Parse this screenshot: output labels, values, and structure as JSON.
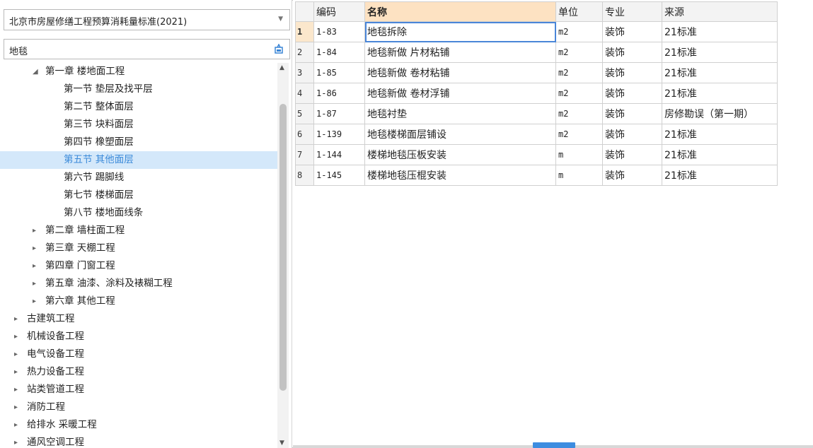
{
  "dropdown": {
    "value": "北京市房屋修缮工程预算消耗量标准(2021)"
  },
  "search": {
    "value": "地毯"
  },
  "tree": [
    {
      "label": "第一章 楼地面工程",
      "level": 1,
      "toggle": "expanded",
      "selected": false
    },
    {
      "label": "第一节 垫层及找平层",
      "level": 2,
      "toggle": "none",
      "selected": false
    },
    {
      "label": "第二节 整体面层",
      "level": 2,
      "toggle": "none",
      "selected": false
    },
    {
      "label": "第三节 块料面层",
      "level": 2,
      "toggle": "none",
      "selected": false
    },
    {
      "label": "第四节 橡塑面层",
      "level": 2,
      "toggle": "none",
      "selected": false
    },
    {
      "label": "第五节 其他面层",
      "level": 2,
      "toggle": "none",
      "selected": true
    },
    {
      "label": "第六节 踢脚线",
      "level": 2,
      "toggle": "none",
      "selected": false
    },
    {
      "label": "第七节 楼梯面层",
      "level": 2,
      "toggle": "none",
      "selected": false
    },
    {
      "label": "第八节 楼地面线条",
      "level": 2,
      "toggle": "none",
      "selected": false
    },
    {
      "label": "第二章 墙柱面工程",
      "level": 1,
      "toggle": "collapsed",
      "selected": false
    },
    {
      "label": "第三章 天棚工程",
      "level": 1,
      "toggle": "collapsed",
      "selected": false
    },
    {
      "label": "第四章 门窗工程",
      "level": 1,
      "toggle": "collapsed",
      "selected": false
    },
    {
      "label": "第五章 油漆、涂料及裱糊工程",
      "level": 1,
      "toggle": "collapsed",
      "selected": false
    },
    {
      "label": "第六章 其他工程",
      "level": 1,
      "toggle": "collapsed",
      "selected": false
    },
    {
      "label": "古建筑工程",
      "level": 0,
      "toggle": "collapsed",
      "selected": false
    },
    {
      "label": "机械设备工程",
      "level": 0,
      "toggle": "collapsed",
      "selected": false
    },
    {
      "label": "电气设备工程",
      "level": 0,
      "toggle": "collapsed",
      "selected": false
    },
    {
      "label": "热力设备工程",
      "level": 0,
      "toggle": "collapsed",
      "selected": false
    },
    {
      "label": "站类管道工程",
      "level": 0,
      "toggle": "collapsed",
      "selected": false
    },
    {
      "label": "消防工程",
      "level": 0,
      "toggle": "collapsed",
      "selected": false
    },
    {
      "label": "给排水 采暖工程",
      "level": 0,
      "toggle": "collapsed",
      "selected": false
    },
    {
      "label": "通风空调工程",
      "level": 0,
      "toggle": "collapsed",
      "selected": false
    }
  ],
  "table": {
    "headers": {
      "code": "编码",
      "name": "名称",
      "unit": "单位",
      "major": "专业",
      "source": "来源"
    },
    "rows": [
      {
        "no": "1",
        "code": "1-83",
        "name": "地毯拆除",
        "unit": "m2",
        "major": "装饰",
        "source": "21标准"
      },
      {
        "no": "2",
        "code": "1-84",
        "name": "地毯新做 片材粘铺",
        "unit": "m2",
        "major": "装饰",
        "source": "21标准"
      },
      {
        "no": "3",
        "code": "1-85",
        "name": "地毯新做 卷材粘铺",
        "unit": "m2",
        "major": "装饰",
        "source": "21标准"
      },
      {
        "no": "4",
        "code": "1-86",
        "name": "地毯新做 卷材浮铺",
        "unit": "m2",
        "major": "装饰",
        "source": "21标准"
      },
      {
        "no": "5",
        "code": "1-87",
        "name": "地毯衬垫",
        "unit": "m2",
        "major": "装饰",
        "source": "房修勘误（第一期）"
      },
      {
        "no": "6",
        "code": "1-139",
        "name": "地毯楼梯面层铺设",
        "unit": "m2",
        "major": "装饰",
        "source": "21标准"
      },
      {
        "no": "7",
        "code": "1-144",
        "name": "楼梯地毯压板安装",
        "unit": "m",
        "major": "装饰",
        "source": "21标准"
      },
      {
        "no": "8",
        "code": "1-145",
        "name": "楼梯地毯压棍安装",
        "unit": "m",
        "major": "装饰",
        "source": "21标准"
      }
    ]
  }
}
